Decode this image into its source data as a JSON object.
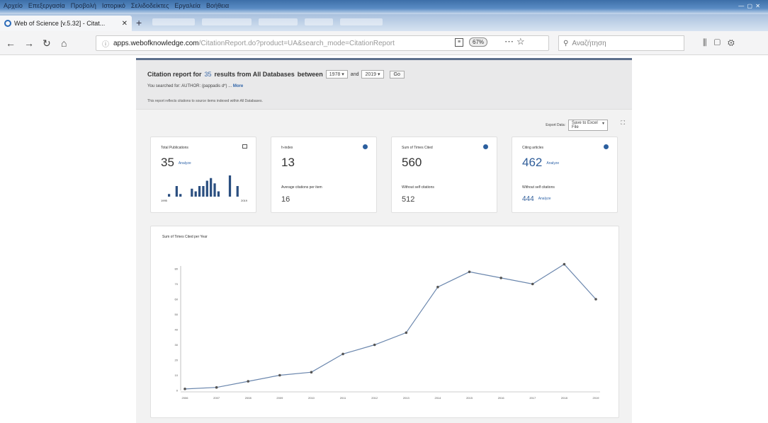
{
  "browser": {
    "menu": [
      "Αρχείο",
      "Επεξεργασία",
      "Προβολή",
      "Ιστορικό",
      "Σελιδοδείκτες",
      "Εργαλεία",
      "Βοήθεια"
    ],
    "tab_title": "Web of Science [v.5.32] - Citat...",
    "url_host": "apps.webofknowledge.com",
    "url_path": "/CitationReport.do?product=UA&search_mode=CitationReport",
    "zoom": "67%",
    "search_placeholder": "Αναζήτηση"
  },
  "report": {
    "title_prefix": "Citation report for",
    "result_count": "35",
    "title_mid": "results from All Databases",
    "between": "between",
    "year_from": "1978",
    "and": "and",
    "year_to": "2019",
    "go": "Go",
    "searched_for": "You searched for: AUTHOR: (pappadis d*) ...",
    "more": "More",
    "note": "This report reflects citations to source items indexed within All Databases.",
    "export_label": "Export Data:",
    "export_option": "Save to Excel File"
  },
  "cards": {
    "total_pubs": {
      "label": "Total Publications",
      "value": "35",
      "link": "Analyze",
      "year_start": "1995",
      "year_end": "2019"
    },
    "h_index": {
      "label": "h-index",
      "value": "13",
      "sub_label": "Average citations per item",
      "sub_value": "16"
    },
    "times_cited": {
      "label": "Sum of Times Cited",
      "value": "560",
      "sub_label": "Without self citations",
      "sub_value": "512"
    },
    "citing": {
      "label": "Citing articles",
      "value": "462",
      "link": "Analyze",
      "sub_label": "Without self citations",
      "sub_value": "444",
      "sub_link": "Analyze"
    }
  },
  "sparkline": [
    1,
    0,
    4,
    1,
    0,
    0,
    3,
    2,
    4,
    4,
    6,
    7,
    5,
    2,
    0,
    0,
    8,
    0,
    4
  ],
  "chart_data": {
    "type": "line",
    "title": "Sum of Times Cited per Year",
    "x": [
      "2006",
      "2007",
      "2008",
      "2009",
      "2010",
      "2011",
      "2012",
      "2013",
      "2014",
      "2015",
      "2016",
      "2017",
      "2018",
      "2019"
    ],
    "values": [
      1,
      2,
      6,
      10,
      12,
      24,
      30,
      38,
      68,
      78,
      74,
      70,
      83,
      60
    ],
    "yticks": [
      "0",
      "10",
      "20",
      "30",
      "40",
      "50",
      "60",
      "70",
      "80"
    ],
    "ylim": [
      0,
      80
    ],
    "colors": {
      "line": "#6a86ad",
      "point": "#555555"
    }
  }
}
